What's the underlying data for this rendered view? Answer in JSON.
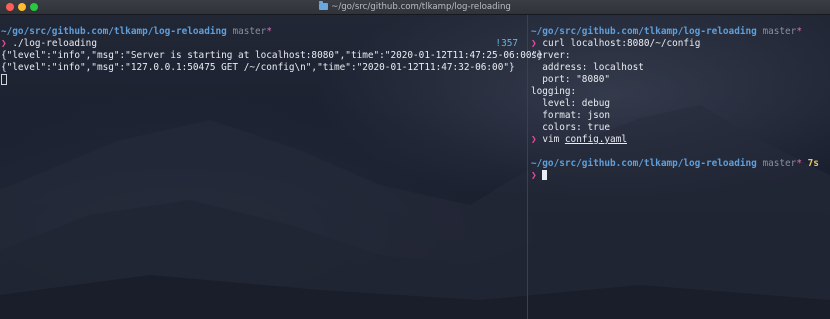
{
  "window": {
    "title": "~/go/src/github.com/tlkamp/log-reloading"
  },
  "left_pane": {
    "prompt_path": "~/go/src/github.com/tlkamp/log-reloading",
    "branch": "master",
    "dirty_marker": "*",
    "prompt_symbol": "❯",
    "command": "./log-reloading",
    "status_count": "!357",
    "output": [
      "{\"level\":\"info\",\"msg\":\"Server is starting at localhost:8080\",\"time\":\"2020-01-12T11:47:25-06:00\"}",
      "{\"level\":\"info\",\"msg\":\"127.0.0.1:50475 GET /~/config\\n\",\"time\":\"2020-01-12T11:47:32-06:00\"}"
    ]
  },
  "right_pane": {
    "prompt_path": "~/go/src/github.com/tlkamp/log-reloading",
    "branch": "master",
    "dirty_marker": "*",
    "prompt_symbol": "❯",
    "command_1": "curl localhost:8080/~/config",
    "config_output": [
      "server:",
      "  address: localhost",
      "  port: \"8080\"",
      "logging:",
      "  level: debug",
      "  format: json",
      "  colors: true"
    ],
    "command_2_program": "vim",
    "command_2_arg": "config.yaml",
    "duration": "7s"
  },
  "colors": {
    "path": "#5f9fdb",
    "prompt": "#e14f9a",
    "branch": "#8a8f9a",
    "duration": "#e3c76b"
  },
  "icons": {
    "window_controls": [
      "close-icon",
      "minimize-icon",
      "maximize-icon"
    ],
    "title_icon": "folder-icon"
  }
}
